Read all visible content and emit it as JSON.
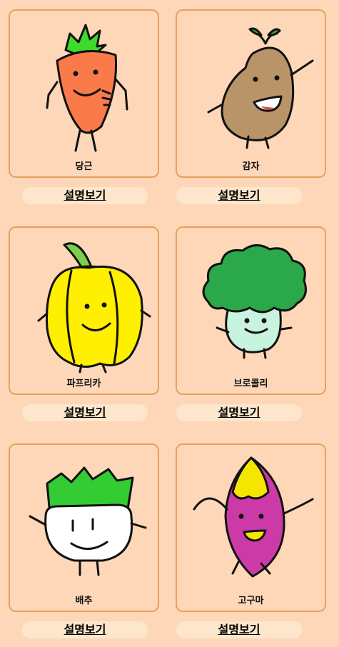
{
  "vegetables": [
    {
      "name": "당근",
      "button": "설명보기",
      "icon": "carrot-character-icon"
    },
    {
      "name": "감자",
      "button": "설명보기",
      "icon": "potato-character-icon"
    },
    {
      "name": "파프리카",
      "button": "설명보기",
      "icon": "paprika-character-icon"
    },
    {
      "name": "브로콜리",
      "button": "설명보기",
      "icon": "broccoli-character-icon"
    },
    {
      "name": "배추",
      "button": "설명보기",
      "icon": "napa-cabbage-character-icon"
    },
    {
      "name": "고구마",
      "button": "설명보기",
      "icon": "sweet-potato-character-icon"
    }
  ],
  "colors": {
    "background": "#fdd7b8",
    "card_border": "#e6a25d",
    "button_bg": "#fde6cc"
  }
}
